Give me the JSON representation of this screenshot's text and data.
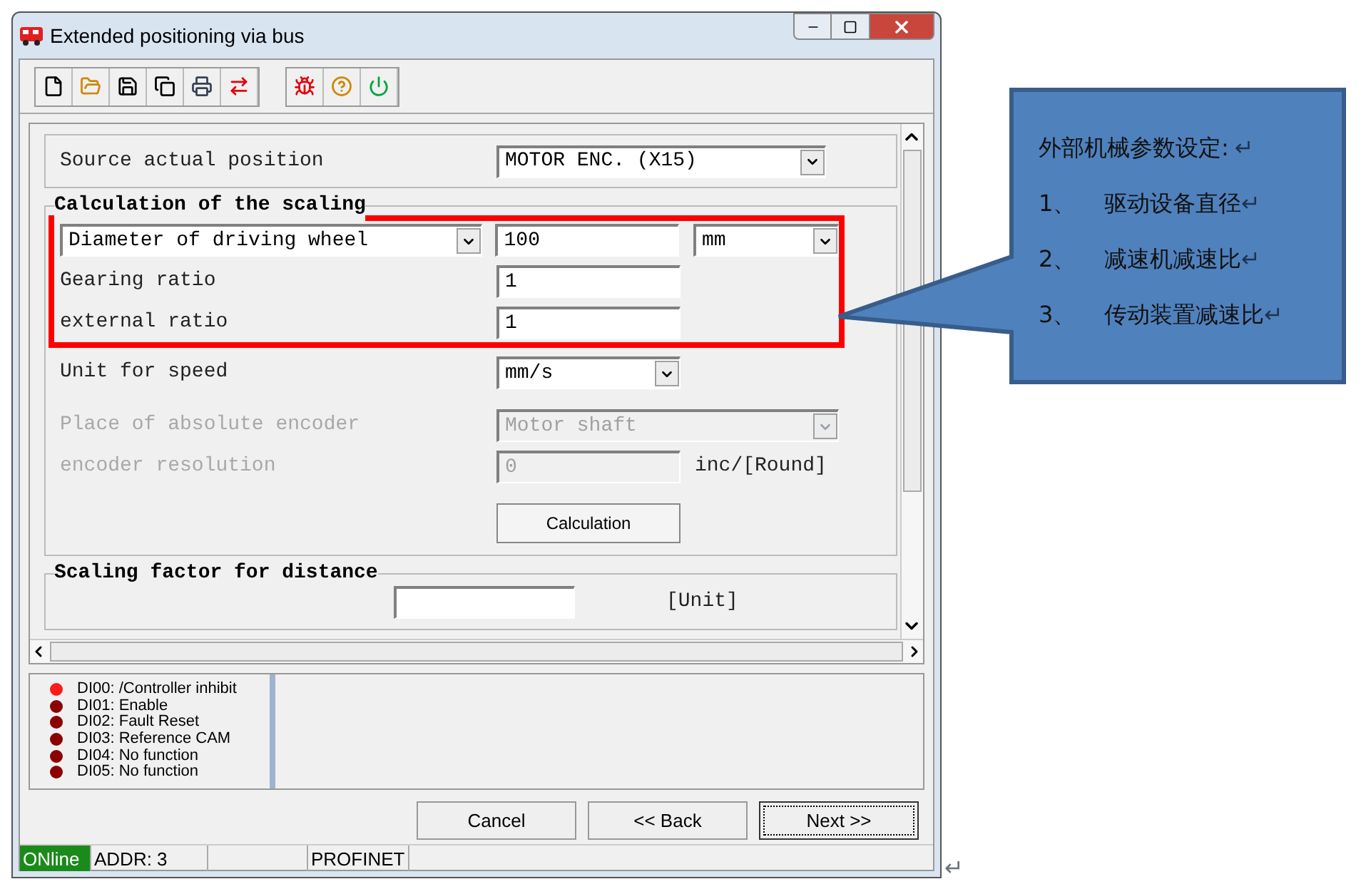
{
  "window": {
    "title": "Extended positioning via bus"
  },
  "toolbar": [
    {
      "kind": "new"
    },
    {
      "kind": "open"
    },
    {
      "kind": "save"
    },
    {
      "kind": "copy"
    },
    {
      "kind": "print"
    },
    {
      "kind": "transfer"
    },
    {
      "kind": "bug"
    },
    {
      "kind": "help"
    },
    {
      "kind": "power"
    }
  ],
  "source": {
    "label": "Source actual position",
    "value": "MOTOR ENC. (X15)"
  },
  "scaling": {
    "title": "Calculation of the scaling",
    "diameter": {
      "label": "Diameter of driving wheel",
      "value": "100",
      "unit": "mm"
    },
    "gearing": {
      "label": "Gearing ratio",
      "value": "1"
    },
    "external": {
      "label": "external ratio",
      "value": "1"
    },
    "speed": {
      "label": "Unit for speed",
      "value": "mm/s"
    },
    "encoder_place": {
      "label": "Place of absolute encoder",
      "value": "Motor shaft",
      "disabled": true
    },
    "encoder_res": {
      "label": "encoder resolution",
      "value": "0",
      "unit": "inc/[Round]",
      "disabled": true
    },
    "button": "Calculation"
  },
  "distance": {
    "title": "Scaling factor for distance",
    "unit": "[Unit]"
  },
  "inputs": [
    {
      "label": "DI00: /Controller inhibit",
      "color": "#ff1a1a"
    },
    {
      "label": "DI01: Enable",
      "color": "#8b0000"
    },
    {
      "label": "DI02: Fault Reset",
      "color": "#8b0000"
    },
    {
      "label": "DI03: Reference CAM",
      "color": "#8b0000"
    },
    {
      "label": "DI04: No function",
      "color": "#8b0000"
    },
    {
      "label": "DI05: No function",
      "color": "#8b0000"
    }
  ],
  "buttons": [
    {
      "label": "Cancel",
      "default": false
    },
    {
      "label": "<< Back",
      "default": false
    },
    {
      "label": "Next >>",
      "default": true
    }
  ],
  "status_bar": [
    {
      "text": "ONline",
      "kind": "online"
    },
    {
      "text": "ADDR: 3",
      "kind": "plain"
    },
    {
      "kind": "plain"
    },
    {
      "text": "PROFINET",
      "kind": "plain"
    }
  ],
  "page_mark": "↵",
  "callout": {
    "title": "外部机械参数设定:",
    "mark": "↵",
    "items": [
      {
        "number": "1、",
        "text": "驱动设备直径",
        "mark": "↵"
      },
      {
        "number": "2、",
        "text": "减速机减速比",
        "mark": "↵"
      },
      {
        "number": "3、",
        "text": "传动装置减速比",
        "mark": "↵"
      }
    ]
  }
}
